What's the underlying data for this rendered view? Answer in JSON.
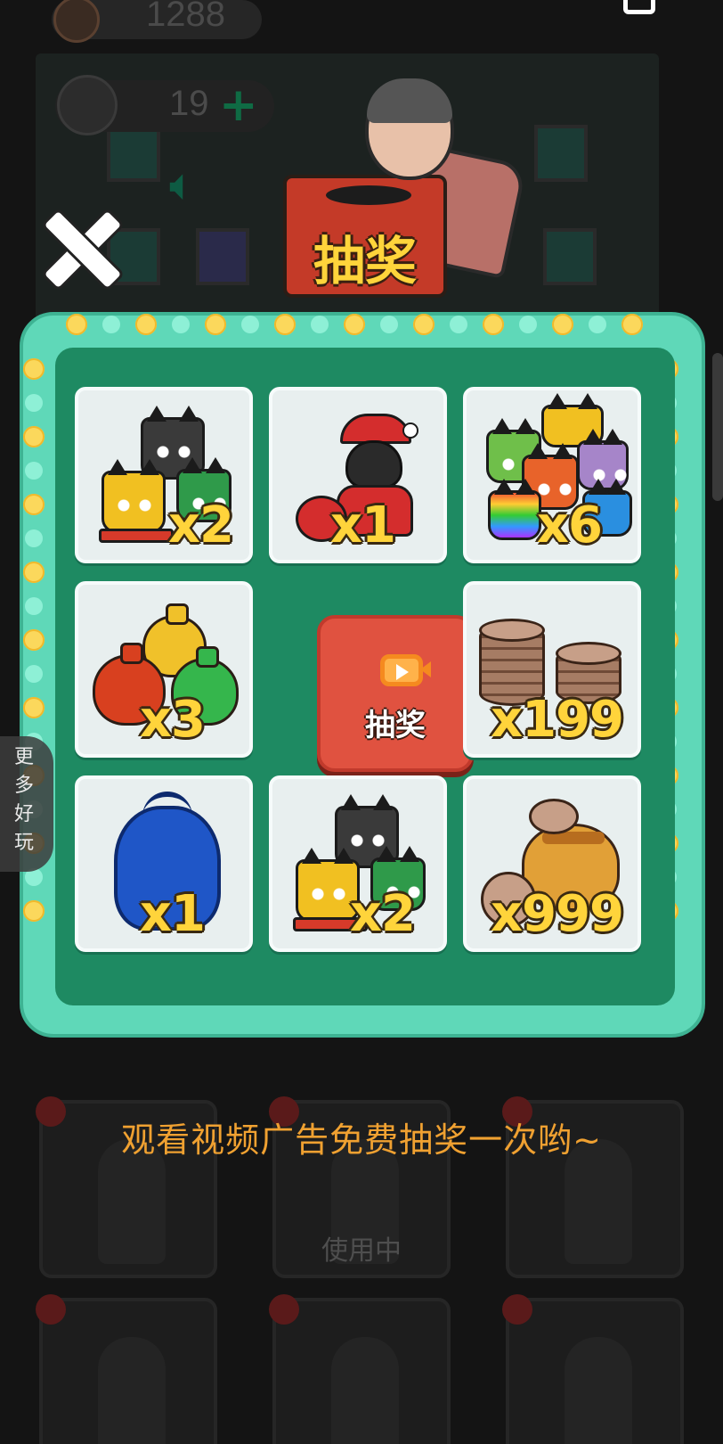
{
  "top_bar": {
    "coins_value": "1288",
    "energy_value": "19",
    "energy_plus_icon": "plus-icon",
    "speaker_icon": "speaker-icon",
    "share_icon": "share-icon"
  },
  "header": {
    "box_label": "抽奖",
    "close_icon": "close-icon"
  },
  "board": {
    "center_button_label": "抽奖",
    "center_button_icon": "video-icon",
    "prizes": [
      {
        "item": "cat-pets",
        "quantity": "x2"
      },
      {
        "item": "santa-costume",
        "quantity": "x1"
      },
      {
        "item": "rainbow-cat-pets",
        "quantity": "x6"
      },
      {
        "item": "gift-bags",
        "quantity": "x3"
      },
      {
        "item": "coin-stacks",
        "quantity": "x199"
      },
      {
        "item": "blue-trash-bag",
        "quantity": "x1"
      },
      {
        "item": "cat-pets",
        "quantity": "x2"
      },
      {
        "item": "money-bag",
        "quantity": "x999"
      }
    ]
  },
  "side_tab": {
    "chars": [
      "更",
      "多",
      "好",
      "玩"
    ]
  },
  "hint_text": "观看视频广告免费抽奖一次哟~",
  "wardrobe": {
    "in_use_label": "使用中"
  },
  "colors": {
    "board_rim": "#5fd8b8",
    "board_inner": "#1e8a62",
    "bulb": "#fbd85c",
    "draw_button": "#e05240",
    "quantity_text": "#ffd43b",
    "hint": "#f0a131"
  }
}
